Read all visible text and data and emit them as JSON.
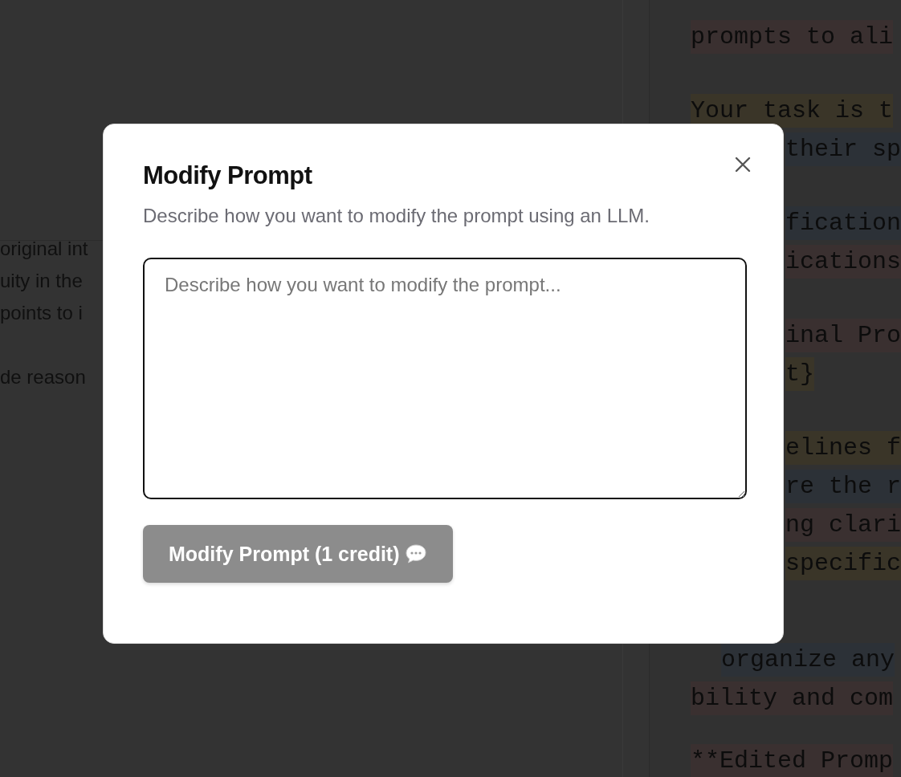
{
  "background": {
    "left_paragraphs": [
      [
        "original int",
        "uity in the",
        "points to i"
      ],
      [
        "de reason"
      ]
    ],
    "code_paragraphs": [
      [
        {
          "text": "prompts to ali",
          "kind": "open"
        }
      ],
      [
        {
          "text": "Your task is t",
          "kind": "open"
        },
        {
          "text": "their sp",
          "kind": "covered"
        }
      ],
      [
        {
          "text": "fication",
          "kind": "covered"
        },
        {
          "text": "ications",
          "kind": "covered"
        }
      ],
      [
        {
          "text": "inal Pro",
          "kind": "covered"
        },
        {
          "text": "t}",
          "kind": "covered"
        }
      ],
      [
        {
          "text": "elines f",
          "kind": "covered"
        },
        {
          "text": "re the r",
          "kind": "covered"
        },
        {
          "text": "ng clari",
          "kind": "covered"
        },
        {
          "text": "specific",
          "kind": "covered"
        }
      ],
      [
        {
          "text": "organize any",
          "kind": "indented"
        },
        {
          "text": "bility and com",
          "kind": "open"
        }
      ],
      [
        {
          "text": "**Edited Promp",
          "kind": "open"
        }
      ]
    ]
  },
  "dialog": {
    "title": "Modify Prompt",
    "description": "Describe how you want to modify the prompt using an LLM.",
    "prompt_field": {
      "placeholder": "Describe how you want to modify the prompt..."
    },
    "submit_button": {
      "label": "Modify Prompt (1 credit)",
      "disabled": true
    }
  }
}
